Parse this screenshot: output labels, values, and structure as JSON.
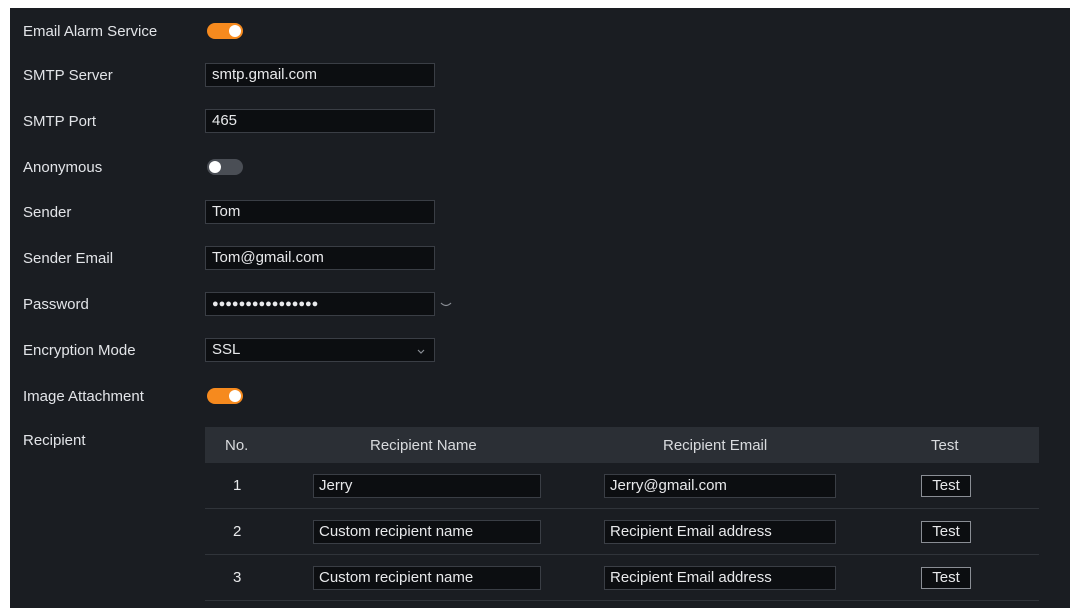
{
  "form": {
    "email_alarm_service": {
      "label": "Email Alarm Service",
      "enabled": true
    },
    "smtp_server": {
      "label": "SMTP Server",
      "value": "smtp.gmail.com"
    },
    "smtp_port": {
      "label": "SMTP Port",
      "value": "465"
    },
    "anonymous": {
      "label": "Anonymous",
      "enabled": false
    },
    "sender": {
      "label": "Sender",
      "value": "Tom"
    },
    "sender_email": {
      "label": "Sender Email",
      "value": "Tom@gmail.com"
    },
    "password": {
      "label": "Password",
      "masked_value": "●●●●●●●●●●●●●●●●",
      "reveal_icon": "eye-icon"
    },
    "encryption_mode": {
      "label": "Encryption Mode",
      "value": "SSL",
      "icon": "chevron-down-icon"
    },
    "image_attachment": {
      "label": "Image Attachment",
      "enabled": true
    },
    "recipient": {
      "label": "Recipient"
    }
  },
  "recipients_table": {
    "headers": {
      "no": "No.",
      "name": "Recipient Name",
      "email": "Recipient Email",
      "test": "Test"
    },
    "rows": [
      {
        "no": "1",
        "name": "Jerry",
        "email": "Jerry@gmail.com",
        "test": "Test"
      },
      {
        "no": "2",
        "name": "Custom recipient name",
        "email": "Recipient Email address",
        "test": "Test"
      },
      {
        "no": "3",
        "name": "Custom recipient name",
        "email": "Recipient Email address",
        "test": "Test"
      }
    ]
  },
  "colors": {
    "background": "#1a1d22",
    "accent": "#f68a1e",
    "toggle_off": "#4a4e55",
    "table_header": "#2b2f35"
  }
}
